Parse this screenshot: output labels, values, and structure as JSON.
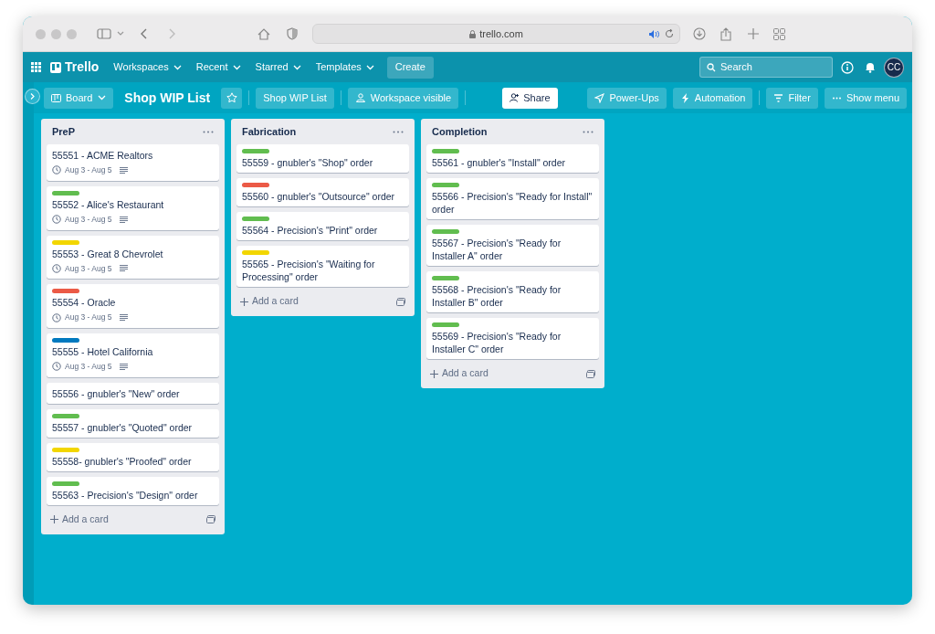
{
  "browser": {
    "address": "trello.com"
  },
  "header": {
    "logo": "Trello",
    "menus": [
      "Workspaces",
      "Recent",
      "Starred",
      "Templates"
    ],
    "create": "Create",
    "search": {
      "placeholder": "Search"
    },
    "avatar": "CC"
  },
  "board_bar": {
    "view": "Board",
    "title": "Shop WIP List",
    "starred": false,
    "workspace_button": "Shop WIP List",
    "visibility": "Workspace visible",
    "share": "Share",
    "right_buttons": [
      {
        "kind": "powerups",
        "label": "Power-Ups"
      },
      {
        "kind": "automation",
        "label": "Automation"
      },
      {
        "kind": "filter",
        "label": "Filter"
      },
      {
        "kind": "menu",
        "label": "Show menu"
      }
    ]
  },
  "lists": [
    {
      "title": "PreP",
      "add_card": "Add a card",
      "cards": [
        {
          "title": "55551 - ACME Realtors",
          "dates": "Aug 3 - Aug 5",
          "description": true
        },
        {
          "color": "#61bd4f",
          "title": "55552 - Alice's Restaurant",
          "dates": "Aug 3 - Aug 5",
          "description": true
        },
        {
          "color": "#f2d600",
          "title": "55553 - Great 8 Chevrolet",
          "dates": "Aug 3 - Aug 5",
          "description": true
        },
        {
          "color": "#eb5a46",
          "title": "55554 - Oracle",
          "dates": "Aug 3 - Aug 5",
          "description": true
        },
        {
          "color": "#0079bf",
          "title": "55555 - Hotel California",
          "dates": "Aug 3 - Aug 5",
          "description": true
        },
        {
          "title": "55556 - gnubler's \"New\" order",
          "description": false
        },
        {
          "color": "#61bd4f",
          "title": "55557 - gnubler's \"Quoted\" order",
          "description": false
        },
        {
          "color": "#f2d600",
          "title": "55558- gnubler's \"Proofed\" order",
          "description": false
        },
        {
          "color": "#61bd4f",
          "title": "55563 - Precision's \"Design\" order",
          "description": false
        }
      ]
    },
    {
      "title": "Fabrication",
      "add_card": "Add a card",
      "cards": [
        {
          "color": "#61bd4f",
          "title": "55559 - gnubler's \"Shop\" order",
          "description": false
        },
        {
          "color": "#eb5a46",
          "title": "55560 - gnubler's \"Outsource\" order",
          "description": false
        },
        {
          "color": "#61bd4f",
          "title": "55564 - Precision's \"Print\" order",
          "description": false
        },
        {
          "color": "#f2d600",
          "title": "55565 - Precision's \"Waiting for Processing\" order",
          "description": false
        }
      ]
    },
    {
      "title": "Completion",
      "add_card": "Add a card",
      "cards": [
        {
          "color": "#61bd4f",
          "title": "55561 - gnubler's \"Install\" order",
          "description": false
        },
        {
          "color": "#61bd4f",
          "title": "55566 - Precision's \"Ready for Install\" order",
          "description": false
        },
        {
          "color": "#61bd4f",
          "title": "55567 - Precision's \"Ready for Installer A\" order",
          "description": false
        },
        {
          "color": "#61bd4f",
          "title": "55568 - Precision's \"Ready for Installer B\" order",
          "description": false
        },
        {
          "color": "#61bd4f",
          "title": "55569 - Precision's \"Ready for Installer C\" order",
          "description": false
        }
      ]
    }
  ]
}
